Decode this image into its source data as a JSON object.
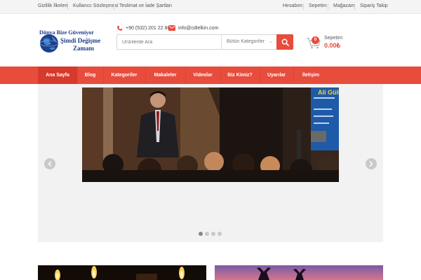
{
  "topbar": {
    "left": [
      "Gizlilik İlkeleri",
      "Kullanıcı Sözleşmesi",
      "Teslimat ve İade Şartları"
    ],
    "right": [
      "Hesabım",
      "Sepetim",
      "Mağazam",
      "Sipariş Takip"
    ]
  },
  "logo": {
    "line1": "Dünya Bize Güveniyor",
    "line2": "Şimdi Değişme",
    "line3": "Zamanı"
  },
  "contact": {
    "phone": "+90 (532) 201 22 86",
    "email": "info@cdtelkin.com"
  },
  "search": {
    "placeholder": "Ürünlerde Ara",
    "category": "Bütün Kategoriler"
  },
  "cart": {
    "count": "0",
    "label": "Sepetim:",
    "total": "0.00₺"
  },
  "nav": [
    "Ana Sayfa",
    "Blog",
    "Kategoriler",
    "Makaleler",
    "Videolar",
    "Biz Kimiz?",
    "Uyarılar",
    "İletişim"
  ],
  "slider": {
    "banner_text": "Ali Gülk",
    "slides": 4,
    "active": 1
  },
  "colors": {
    "accent": "#e74c3c",
    "accent_dark": "#d63a2c",
    "logo_blue": "#1d3f8a"
  }
}
